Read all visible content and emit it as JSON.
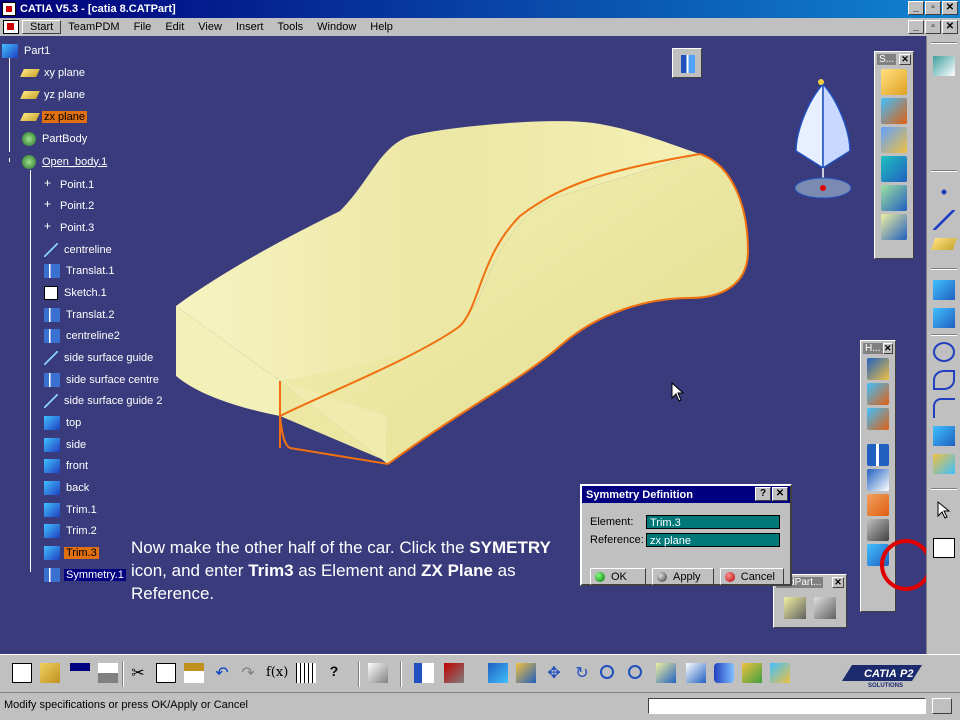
{
  "window": {
    "title": "CATIA V5.3 - [catia 8.CATPart]",
    "min_label": "_",
    "max_label": "▫",
    "close_label": "✕"
  },
  "menu": {
    "items": [
      "Start",
      "TeamPDM",
      "File",
      "Edit",
      "View",
      "Insert",
      "Tools",
      "Window",
      "Help"
    ]
  },
  "tree": {
    "root": "Part1",
    "items": [
      {
        "label": "xy plane",
        "icon": "plane-icon",
        "style": ""
      },
      {
        "label": "yz plane",
        "icon": "plane-icon",
        "style": ""
      },
      {
        "label": "zx plane",
        "icon": "plane-icon",
        "style": "sel"
      },
      {
        "label": "PartBody",
        "icon": "partbody-icon",
        "style": ""
      },
      {
        "label": "Open_body.1",
        "icon": "open-body-icon",
        "style": "ul"
      },
      {
        "label": "Point.1",
        "icon": "point-icon",
        "style": ""
      },
      {
        "label": "Point.2",
        "icon": "point-icon",
        "style": ""
      },
      {
        "label": "Point.3",
        "icon": "point-icon",
        "style": ""
      },
      {
        "label": "centreline",
        "icon": "line-icon",
        "style": ""
      },
      {
        "label": "Translat.1",
        "icon": "translate-icon",
        "style": ""
      },
      {
        "label": "Sketch.1",
        "icon": "sketch-icon",
        "style": ""
      },
      {
        "label": "Translat.2",
        "icon": "translate-icon",
        "style": ""
      },
      {
        "label": "centreline2",
        "icon": "translate-icon",
        "style": ""
      },
      {
        "label": "side surface guide",
        "icon": "line-icon",
        "style": ""
      },
      {
        "label": "side surface centre",
        "icon": "translate-icon",
        "style": ""
      },
      {
        "label": "side surface guide 2",
        "icon": "line-icon",
        "style": ""
      },
      {
        "label": "top",
        "icon": "surface-icon",
        "style": ""
      },
      {
        "label": "side",
        "icon": "surface-icon",
        "style": ""
      },
      {
        "label": "front",
        "icon": "surface-icon",
        "style": ""
      },
      {
        "label": "back",
        "icon": "surface-icon",
        "style": ""
      },
      {
        "label": "Trim.1",
        "icon": "trim-icon",
        "style": ""
      },
      {
        "label": "Trim.2",
        "icon": "trim-icon",
        "style": ""
      },
      {
        "label": "Trim.3",
        "icon": "trim-icon",
        "style": "sel"
      },
      {
        "label": "Symmetry.1",
        "icon": "symmetry-icon",
        "style": "hl"
      }
    ]
  },
  "caption": {
    "t1": "Now make the other half of the car. Click the ",
    "b1": "SYMETRY",
    "t2": " icon, and enter ",
    "b2": "Trim3",
    "t3": " as Element and ",
    "b3": "ZX Plane",
    "t4": " as Reference."
  },
  "dialog": {
    "title": "Symmetry Definition",
    "help_label": "?",
    "close_label": "✕",
    "element_label": "Element:",
    "element_value": "Trim.3",
    "reference_label": "Reference:",
    "reference_value": "zx plane",
    "ok_label": "OK",
    "apply_label": "Apply",
    "cancel_label": "Cancel"
  },
  "toolbars": {
    "s_label": "S...",
    "h_label": "H...",
    "bond_label": "ondPart..."
  },
  "logo": {
    "brand": "CATIA",
    "suffix": "P2",
    "sub": "SOLUTIONS"
  },
  "status": {
    "text": "Modify specifications or press OK/Apply or Cancel"
  },
  "colors": {
    "viewport_bg": "#3a3b7c",
    "car_fill": "#f1eeaa",
    "car_edge": "#f07010",
    "highlight_circle": "#e00000"
  }
}
